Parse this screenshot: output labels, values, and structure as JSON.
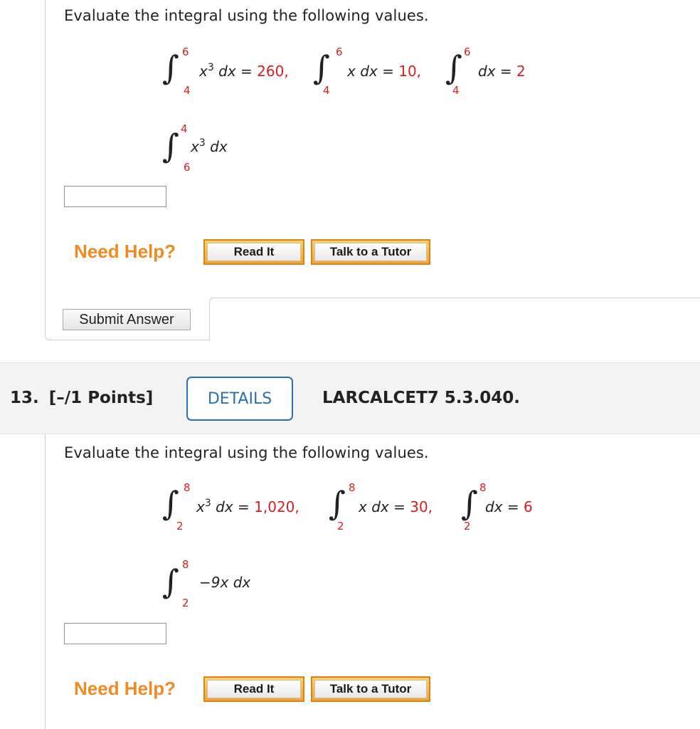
{
  "q12": {
    "prompt": "Evaluate the integral using the following values.",
    "given": [
      {
        "upper": "6",
        "lower": "4",
        "integrand": "x",
        "power": "3",
        "differential": "dx",
        "equals": "=",
        "value": "260,"
      },
      {
        "upper": "6",
        "lower": "4",
        "integrand": "x",
        "power": "",
        "differential": "dx",
        "equals": "=",
        "value": "10,"
      },
      {
        "upper": "6",
        "lower": "4",
        "integrand": "",
        "power": "",
        "differential": "dx",
        "equals": "=",
        "value": "2"
      }
    ],
    "target": {
      "upper": "4",
      "lower": "6",
      "integrand": "x",
      "power": "3",
      "differential": "dx"
    },
    "answer_value": "",
    "need_help": "Need Help?",
    "read_it": "Read It",
    "talk_tutor": "Talk to a Tutor",
    "submit": "Submit Answer"
  },
  "q13": {
    "number": "13.",
    "points": "[–/1 Points]",
    "details": "DETAILS",
    "reference": "LARCALCET7 5.3.040.",
    "prompt": "Evaluate the integral using the following values.",
    "given": [
      {
        "upper": "8",
        "lower": "2",
        "integrand": "x",
        "power": "3",
        "differential": "dx",
        "equals": "=",
        "value": "1,020,"
      },
      {
        "upper": "8",
        "lower": "2",
        "integrand": "x",
        "power": "",
        "differential": "dx",
        "equals": "=",
        "value": "30,"
      },
      {
        "upper": "8",
        "lower": "2",
        "integrand": "",
        "power": "",
        "differential": "dx",
        "equals": "=",
        "value": "6"
      }
    ],
    "target": {
      "upper": "8",
      "lower": "2",
      "integrand": "−9x",
      "power": "",
      "differential": "dx"
    },
    "answer_value": "",
    "need_help": "Need Help?",
    "read_it": "Read It",
    "talk_tutor": "Talk to a Tutor"
  },
  "colors": {
    "accent_blue": "#2a6fb0",
    "help_orange": "#f08a24",
    "math_red": "#d42020"
  }
}
